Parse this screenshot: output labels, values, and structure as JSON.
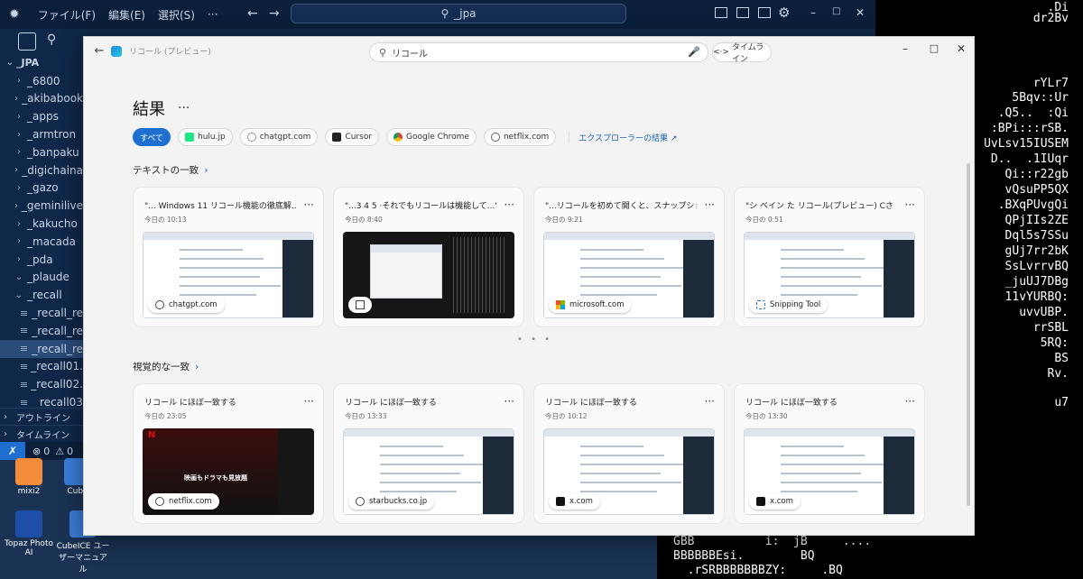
{
  "vscode": {
    "menu": [
      "ファイル(F)",
      "編集(E)",
      "選択(S)",
      "···"
    ],
    "search": "_jpa",
    "root": "_JPA",
    "tree": [
      {
        "label": "_6800",
        "open": false
      },
      {
        "label": "_akibabook",
        "open": false
      },
      {
        "label": "_apps",
        "open": false
      },
      {
        "label": "_armtron",
        "open": false
      },
      {
        "label": "_banpaku",
        "open": false
      },
      {
        "label": "_digichaina",
        "open": false
      },
      {
        "label": "_gazo",
        "open": false
      },
      {
        "label": "_geminilive",
        "open": false
      },
      {
        "label": "_kakucho",
        "open": false
      },
      {
        "label": "_macada",
        "open": false
      },
      {
        "label": "_pda",
        "open": false
      },
      {
        "label": "_plaude",
        "open": true
      },
      {
        "label": "_recall",
        "open": true
      },
      {
        "label": "_recall_re",
        "file": true
      },
      {
        "label": "_recall_re",
        "file": true
      },
      {
        "label": "_recall_re",
        "file": true,
        "selected": true
      },
      {
        "label": "_recall01.",
        "file": true
      },
      {
        "label": "_recall02.",
        "file": true
      },
      {
        "label": "_recall03",
        "file": true
      }
    ],
    "outline": "アウトライン",
    "timeline": "タイムライン",
    "status_errors": "0",
    "status_warnings": "0"
  },
  "desktop": {
    "icons": [
      {
        "label": "mixi2",
        "color": "#f28c38"
      },
      {
        "label": "Cube",
        "color": "#3a7bd5"
      },
      {
        "label": "Topaz Photo AI",
        "color": "#1e4fa8"
      },
      {
        "label": "CubeICE ユーザーマニュアル",
        "color": "#3a7bd5"
      }
    ]
  },
  "terminal": {
    "right_lines": [
      ".Di",
      "dr2Bv",
      "rYLr7",
      "5Bqv::Ur",
      ".Q5..  :Qi",
      ":BPi:::rSB.",
      "UvLsv15IUSEM",
      "D..  .1IUqr",
      "Qi::r22gb",
      "vQsuPP5QX",
      ".BXqPUvgQi",
      "QPjIIs2ZE",
      "Dql5s7SSu",
      "gUj7rr2bK",
      "SsLvrrvBQ",
      "_juUJ7DBg",
      "11vYURBQ:",
      "uvvUBP.",
      "rrSBL",
      "5RQ:",
      "BS",
      "Rv.",
      "u7"
    ],
    "bottom_lines": [
      "GBB          i:  jB     ....",
      "BBBBBBEsi.        BQ",
      "  .rSRBBBBBBBZY:     .BQ"
    ]
  },
  "recall": {
    "app_title": "リコール (プレビュー)",
    "search_value": "リコール",
    "timeline_label": "タイムライン",
    "results_heading": "結果",
    "results_more": "···",
    "filters": [
      {
        "label": "すべて",
        "active": true
      },
      {
        "label": "hulu.jp",
        "icon": "hulu-icon",
        "color": "#1ce783"
      },
      {
        "label": "chatgpt.com",
        "icon": "chatgpt-icon",
        "color": "#999"
      },
      {
        "label": "Cursor",
        "icon": "cursor-icon",
        "color": "#222"
      },
      {
        "label": "Google Chrome",
        "icon": "chrome-icon",
        "color": "#e8a317"
      },
      {
        "label": "netflix.com",
        "icon": "globe-icon",
        "color": "#666"
      }
    ],
    "explorer_link": "エクスプローラーの結果 ↗",
    "text_matches": {
      "heading": "テキストの一致",
      "cards": [
        {
          "title": "\"... Windows 11 リコール機能の徹底解...\"",
          "date": "今日の 10:13",
          "badge": "chatgpt.com",
          "badge_icon": "chatgpt-icon",
          "thumb": "light"
        },
        {
          "title": "\"...3 4 5 ·それでもリコールは機能して...\"",
          "date": "今日の 8:40",
          "badge": "",
          "badge_icon": "snap-icon",
          "thumb": "dark"
        },
        {
          "title": "\"...リコールを初めて開くと、スナップショットの...\"",
          "date": "今日の 9:21",
          "badge": "microsoft.com",
          "badge_icon": "microsoft-icon",
          "thumb": "light"
        },
        {
          "title": "\"シ ベイン た リコール(プレビュー) Cさ ここに...\"",
          "date": "今日の 0:51",
          "badge": "Snipping Tool",
          "badge_icon": "snipping-tool-icon",
          "thumb": "light"
        }
      ]
    },
    "visual_matches": {
      "heading": "視覚的な一致",
      "cards": [
        {
          "title": "リコール にほぼ一致する",
          "date": "今日の 23:05",
          "badge": "netflix.com",
          "badge_icon": "globe-icon",
          "thumb": "netflix",
          "banner": "映画もドラマも見放題"
        },
        {
          "title": "リコール にほぼ一致する",
          "date": "今日の 13:33",
          "badge": "starbucks.co.jp",
          "badge_icon": "globe-icon",
          "thumb": "light"
        },
        {
          "title": "リコール にほぼ一致する",
          "date": "今日の 10:12",
          "badge": "x.com",
          "badge_icon": "x-icon",
          "thumb": "light"
        },
        {
          "title": "リコール にほぼ一致する",
          "date": "今日の 13:30",
          "badge": "x.com",
          "badge_icon": "x-icon",
          "thumb": "light"
        }
      ]
    },
    "pager_dots": "• • •",
    "card_more": "···"
  }
}
